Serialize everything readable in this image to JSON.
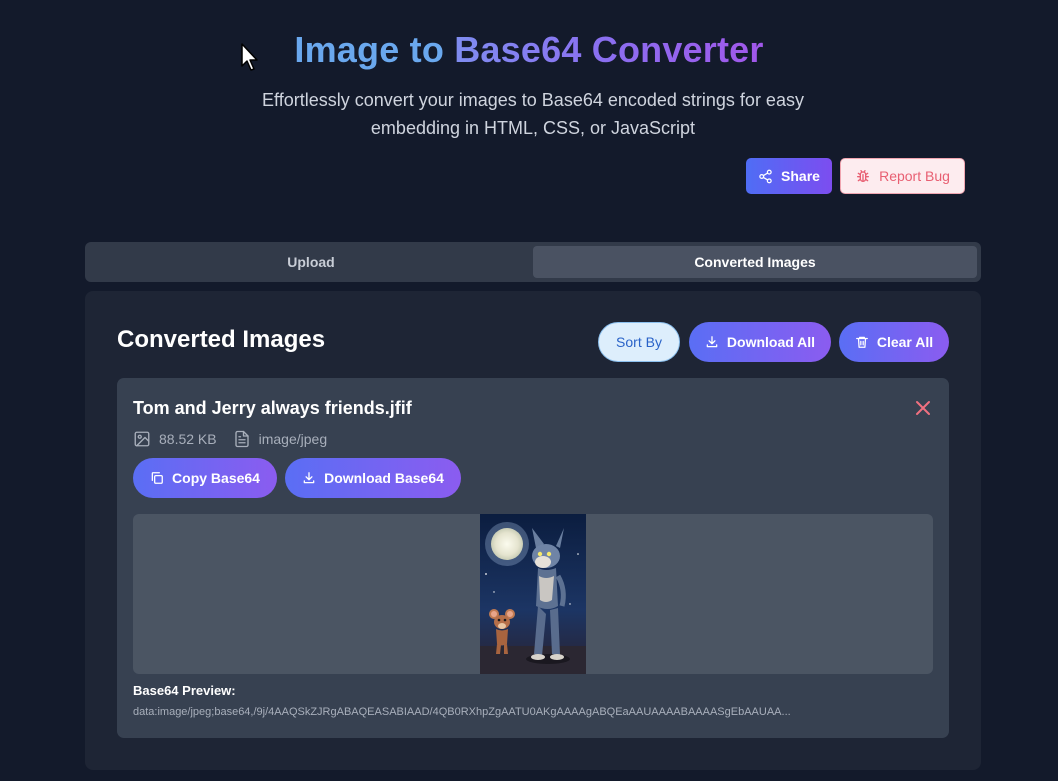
{
  "header": {
    "title_part1": "Image to",
    "title_part2": "Base64 Converter",
    "subtitle": "Effortlessly convert your images to Base64 encoded strings for easy embedding in HTML, CSS, or JavaScript",
    "share_label": "Share",
    "report_bug_label": "Report Bug"
  },
  "tabs": [
    {
      "label": "Upload",
      "active": false
    },
    {
      "label": "Converted Images",
      "active": true
    }
  ],
  "panel": {
    "title": "Converted Images",
    "sort_label": "Sort By",
    "download_all_label": "Download All",
    "clear_all_label": "Clear All"
  },
  "card": {
    "filename": "Tom and Jerry always friends.jfif",
    "size": "88.52 KB",
    "mime": "image/jpeg",
    "copy_label": "Copy Base64",
    "download_label": "Download Base64",
    "preview_label": "Base64 Preview:",
    "preview_text": "data:image/jpeg;base64,/9j/4AAQSkZJRgABAQEASABIAAD/4QB0RXhpZgAATU0AKgAAAAgABQEaAAUAAAABAAAASgEbAAUAA..."
  },
  "colors": {
    "background": "#131a2b",
    "panel": "#1e2535",
    "card": "#374151",
    "accent_start": "#5a6ef4",
    "accent_end": "#8b5cf0",
    "danger": "#e85f72"
  },
  "icons": {
    "share": "share-icon",
    "bug": "bug-icon",
    "download": "download-icon",
    "trash": "trash-icon",
    "close": "close-icon",
    "image": "image-icon",
    "file": "file-icon",
    "copy": "copy-icon"
  }
}
